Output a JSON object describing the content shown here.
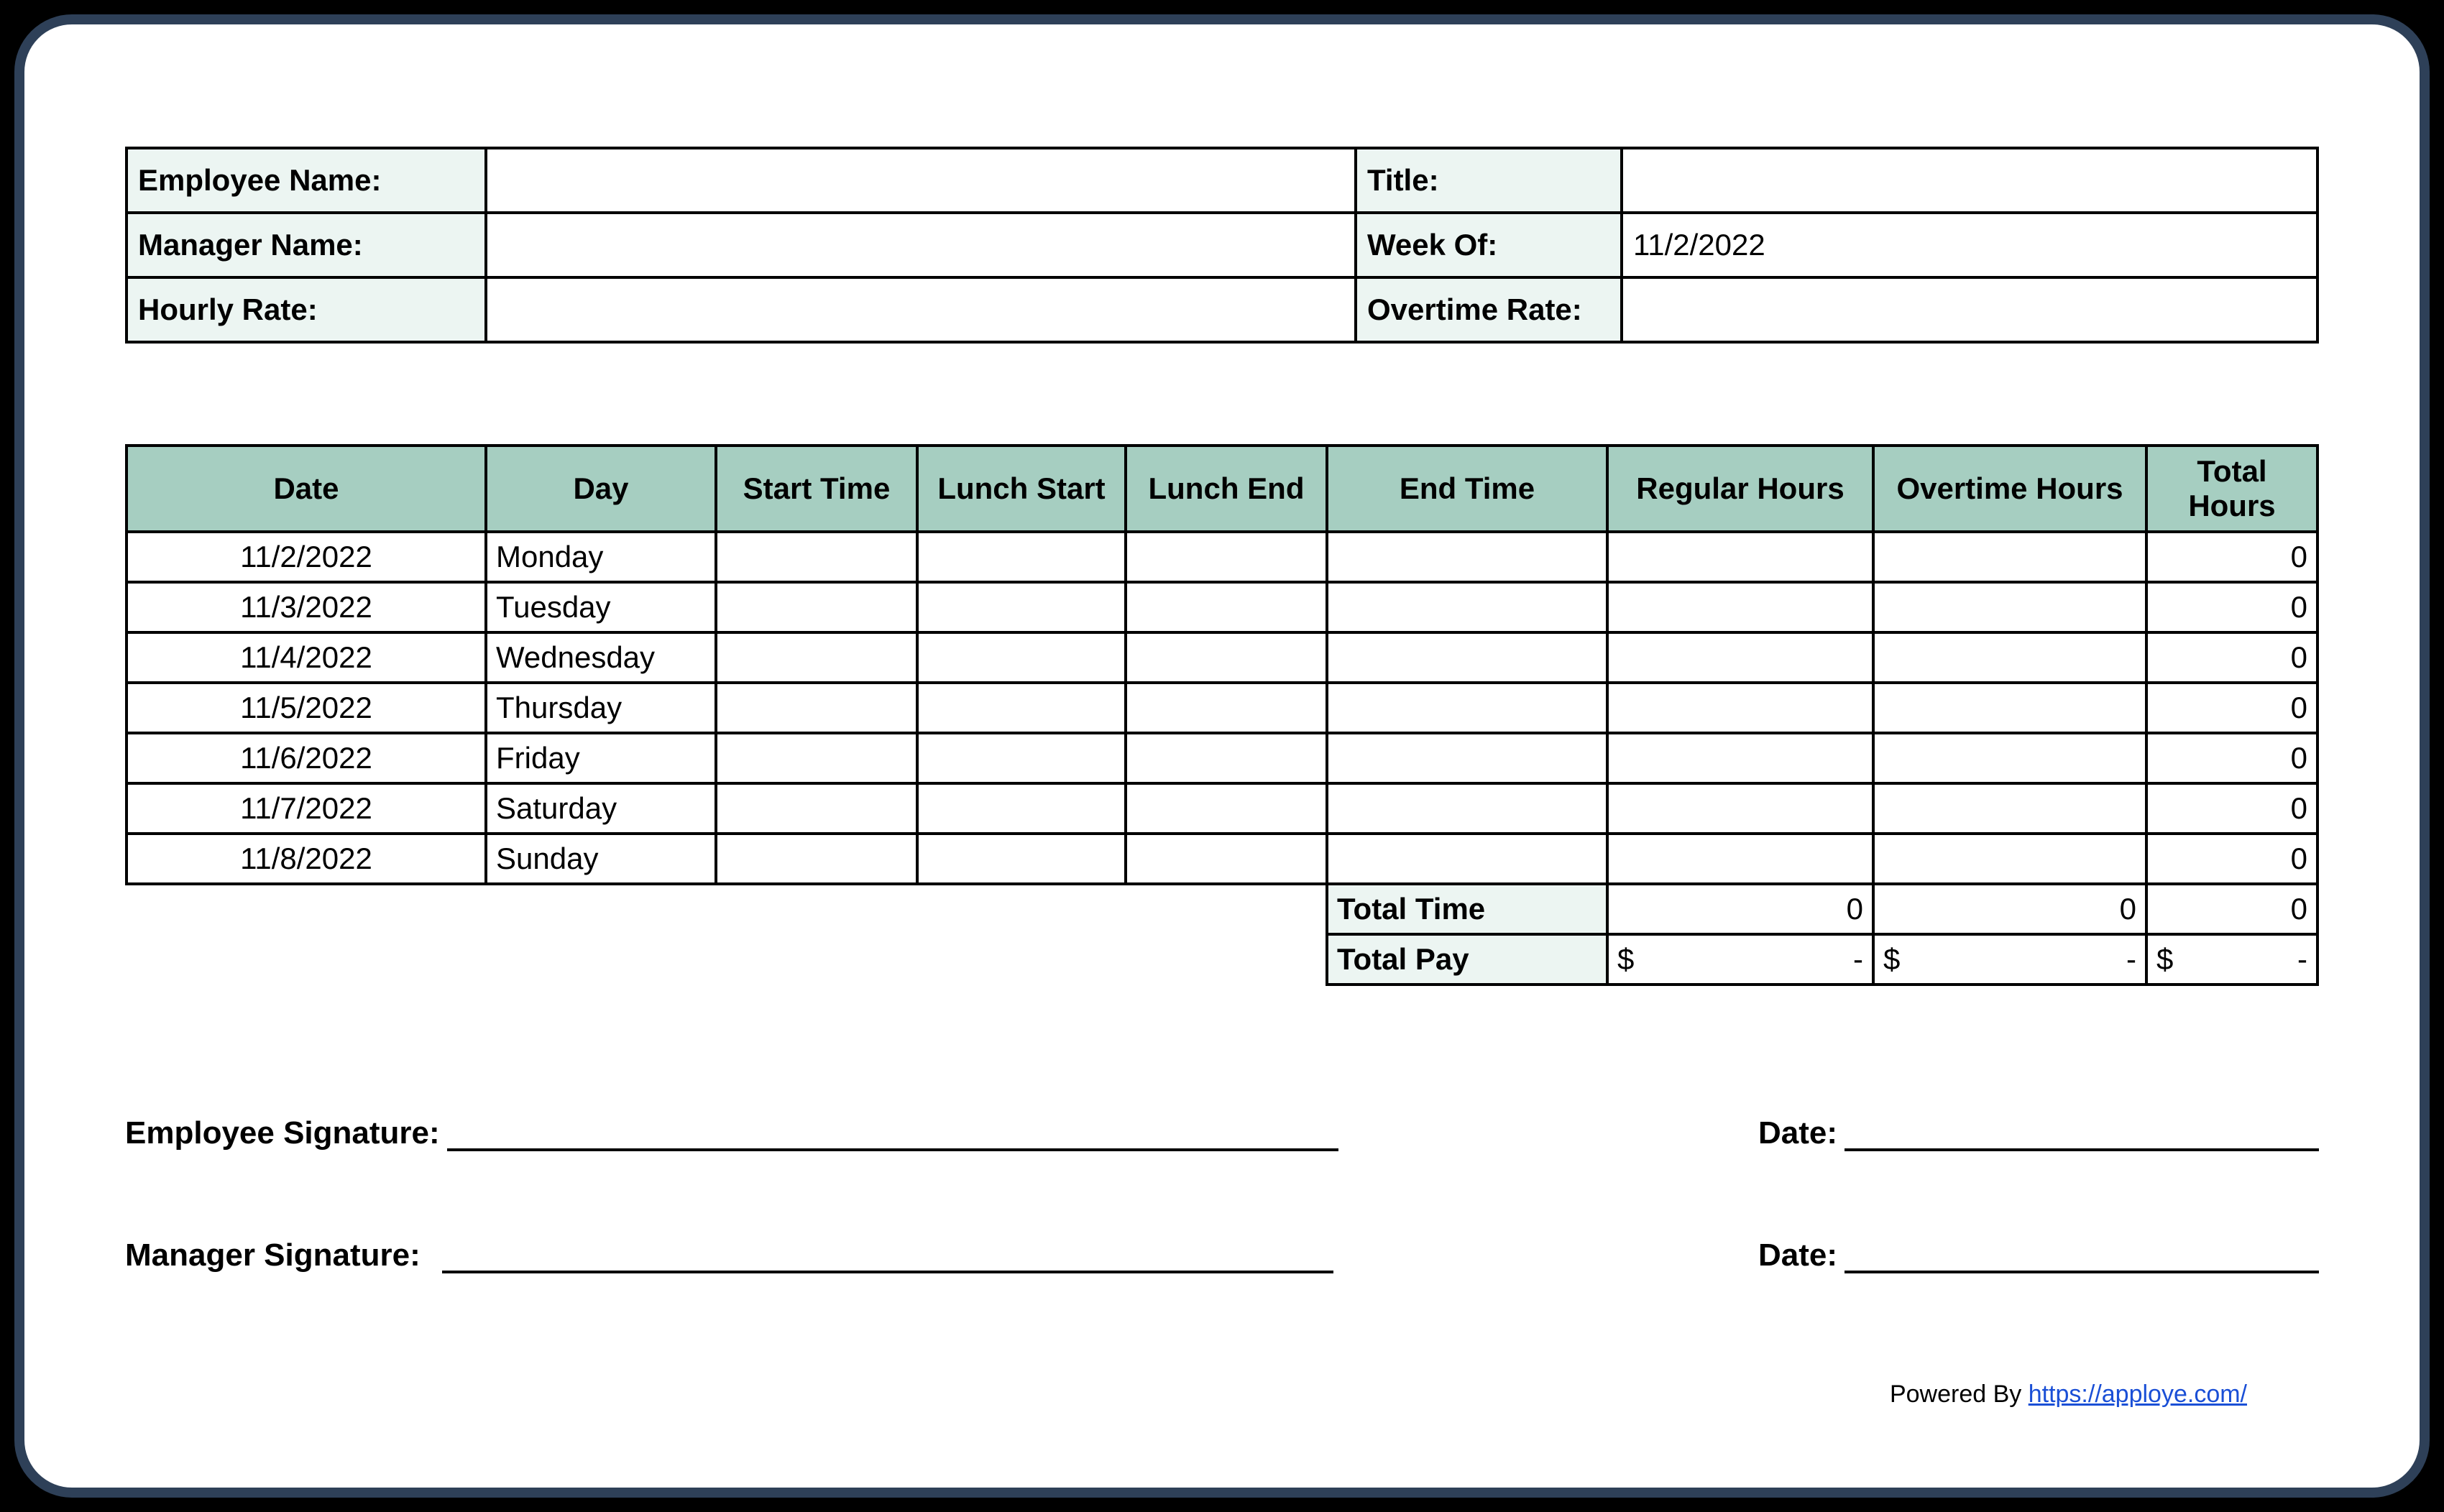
{
  "header": {
    "employee_name_label": "Employee Name:",
    "employee_name_value": "",
    "title_label": "Title:",
    "title_value": "",
    "manager_name_label": "Manager Name:",
    "manager_name_value": "",
    "week_of_label": "Week Of:",
    "week_of_value": "11/2/2022",
    "hourly_rate_label": "Hourly Rate:",
    "hourly_rate_value": "",
    "overtime_rate_label": "Overtime Rate:",
    "overtime_rate_value": ""
  },
  "columns": {
    "date": "Date",
    "day": "Day",
    "start_time": "Start Time",
    "lunch_start": "Lunch Start",
    "lunch_end": "Lunch End",
    "end_time": "End Time",
    "regular_hours": "Regular Hours",
    "overtime_hours": "Overtime Hours",
    "total_hours": "Total Hours"
  },
  "rows": [
    {
      "date": "11/2/2022",
      "day": "Monday",
      "start": "",
      "lunch_start": "",
      "lunch_end": "",
      "end": "",
      "reg": "",
      "ot": "",
      "total": "0"
    },
    {
      "date": "11/3/2022",
      "day": "Tuesday",
      "start": "",
      "lunch_start": "",
      "lunch_end": "",
      "end": "",
      "reg": "",
      "ot": "",
      "total": "0"
    },
    {
      "date": "11/4/2022",
      "day": "Wednesday",
      "start": "",
      "lunch_start": "",
      "lunch_end": "",
      "end": "",
      "reg": "",
      "ot": "",
      "total": "0"
    },
    {
      "date": "11/5/2022",
      "day": "Thursday",
      "start": "",
      "lunch_start": "",
      "lunch_end": "",
      "end": "",
      "reg": "",
      "ot": "",
      "total": "0"
    },
    {
      "date": "11/6/2022",
      "day": "Friday",
      "start": "",
      "lunch_start": "",
      "lunch_end": "",
      "end": "",
      "reg": "",
      "ot": "",
      "total": "0"
    },
    {
      "date": "11/7/2022",
      "day": "Saturday",
      "start": "",
      "lunch_start": "",
      "lunch_end": "",
      "end": "",
      "reg": "",
      "ot": "",
      "total": "0"
    },
    {
      "date": "11/8/2022",
      "day": "Sunday",
      "start": "",
      "lunch_start": "",
      "lunch_end": "",
      "end": "",
      "reg": "",
      "ot": "",
      "total": "0"
    }
  ],
  "sum": {
    "total_time_label": "Total Time",
    "total_time_reg": "0",
    "total_time_ot": "0",
    "total_time_total": "0",
    "total_pay_label": "Total Pay",
    "currency": "$",
    "dash": "-"
  },
  "sign": {
    "employee_signature": "Employee Signature:",
    "manager_signature": "Manager Signature:",
    "date": "Date:"
  },
  "footer": {
    "powered_by": "Powered By ",
    "link_text": "https://apploye.com/"
  }
}
